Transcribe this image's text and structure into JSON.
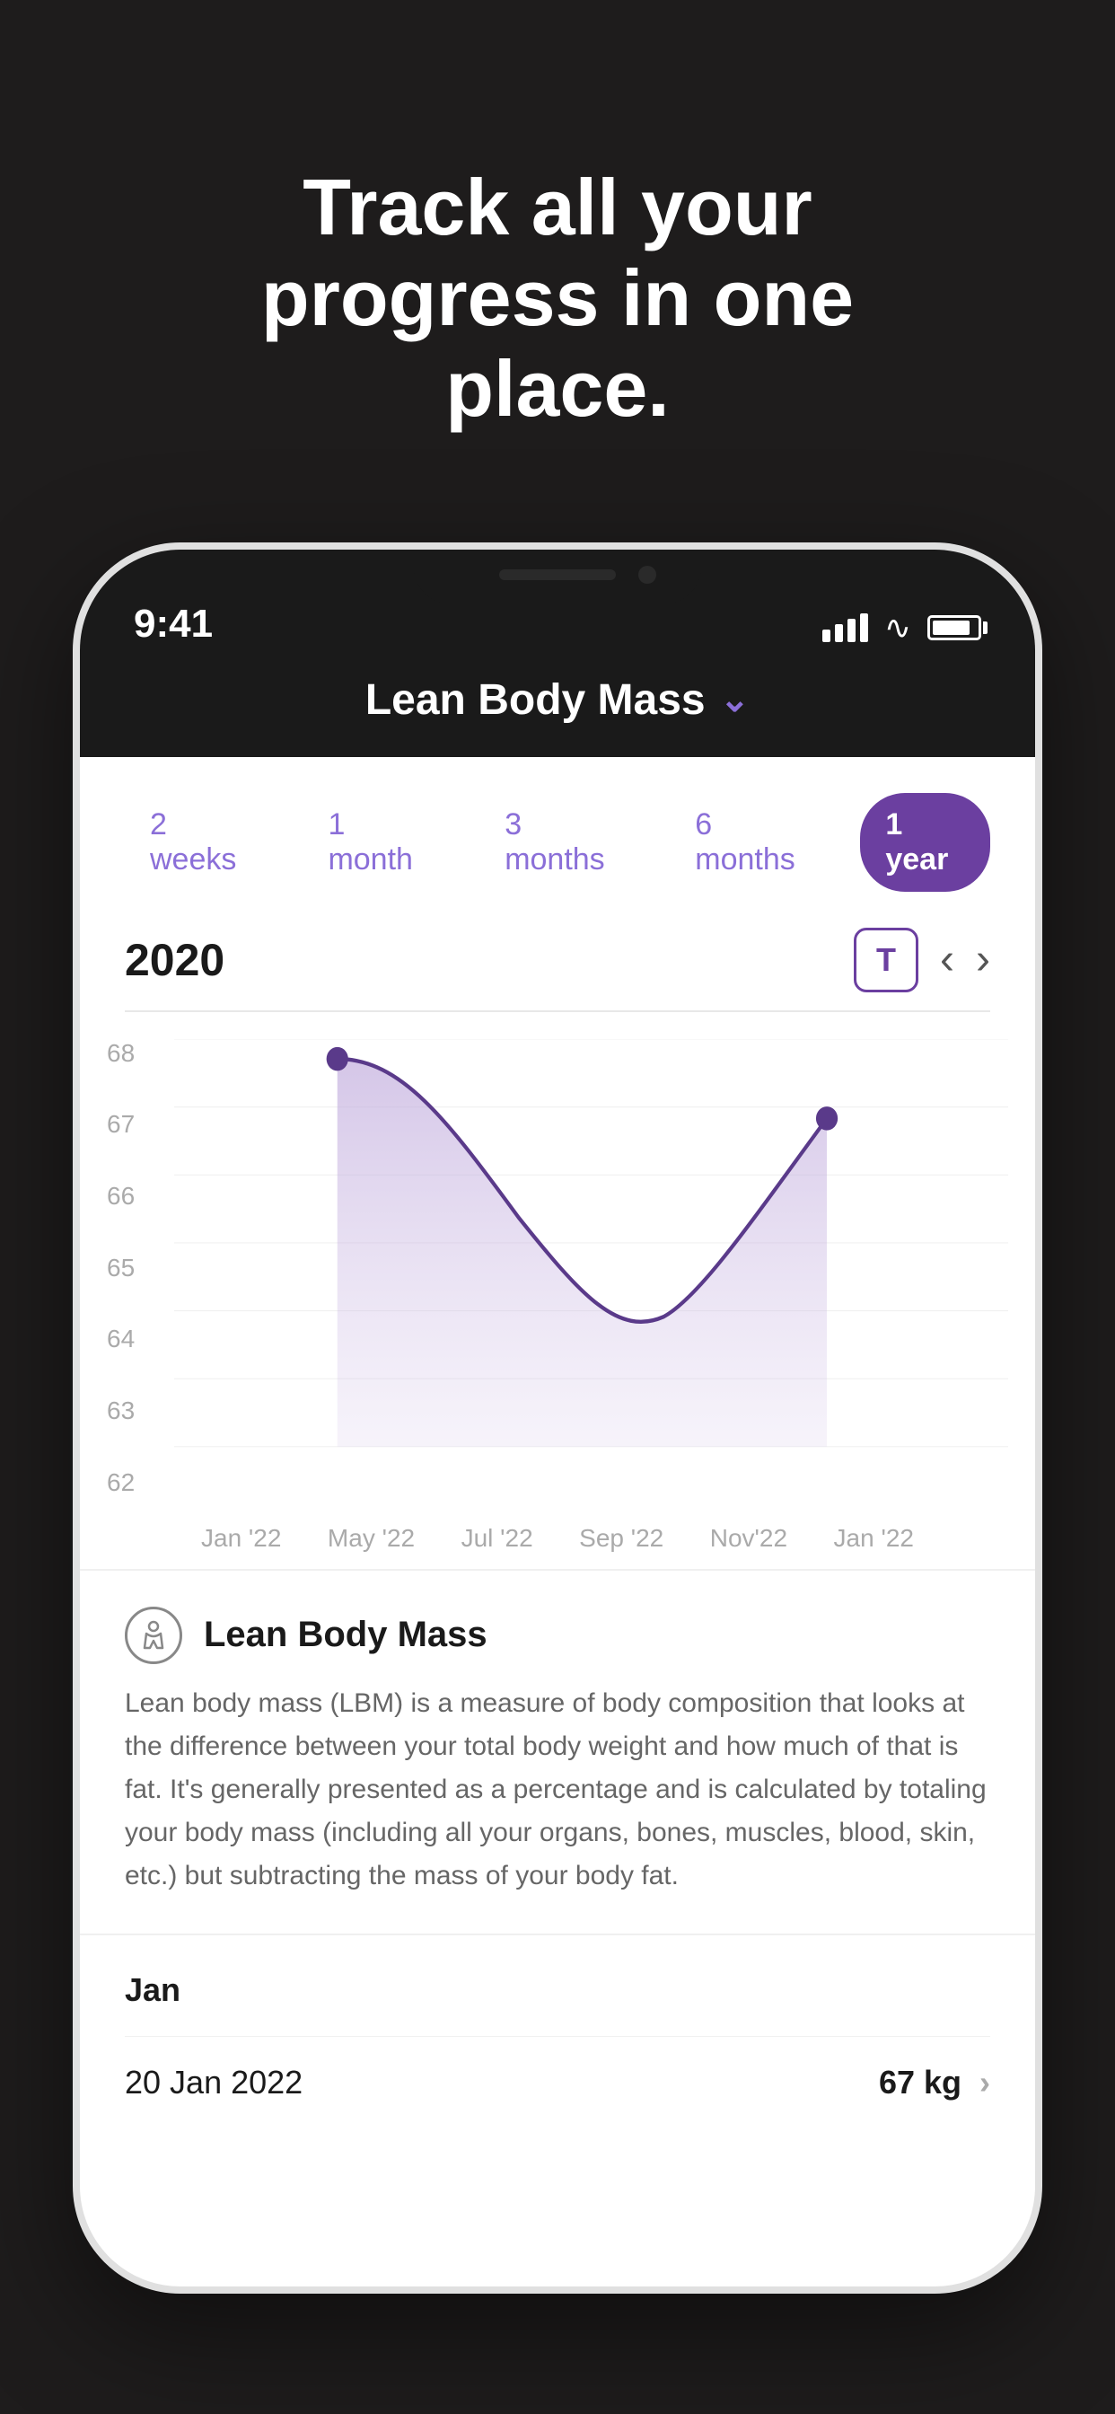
{
  "hero": {
    "title": "Track all your progress in one place."
  },
  "phone": {
    "status": {
      "time": "9:41",
      "signal": true,
      "wifi": true,
      "battery": true
    },
    "header": {
      "title": "Lean Body Mass",
      "chevron": "▾"
    },
    "timeTabs": [
      {
        "label": "2 weeks",
        "active": false
      },
      {
        "label": "1 month",
        "active": false
      },
      {
        "label": "3 months",
        "active": false
      },
      {
        "label": "6 months",
        "active": false
      },
      {
        "label": "1 year",
        "active": true
      }
    ],
    "chart": {
      "year": "2020",
      "tableButtonLabel": "T",
      "yLabels": [
        "68",
        "67",
        "66",
        "65",
        "64",
        "63",
        "62"
      ],
      "xLabels": [
        "Jan '22",
        "May '22",
        "Jul '22",
        "Sep '22",
        "Nov'22",
        "Jan '22"
      ]
    },
    "infoSection": {
      "iconSymbol": "◎",
      "title": "Lean Body Mass",
      "body": "Lean body mass (LBM) is a measure of body composition that looks at the difference between your total body weight and how much of that is fat. It's generally presented as a percentage and is calculated by totaling your body mass (including all your organs, bones, muscles, blood, skin, etc.) but subtracting the mass of your body fat."
    },
    "dataSection": {
      "monthLabel": "Jan",
      "entries": [
        {
          "date": "20 Jan 2022",
          "value": "67 kg"
        }
      ]
    }
  }
}
